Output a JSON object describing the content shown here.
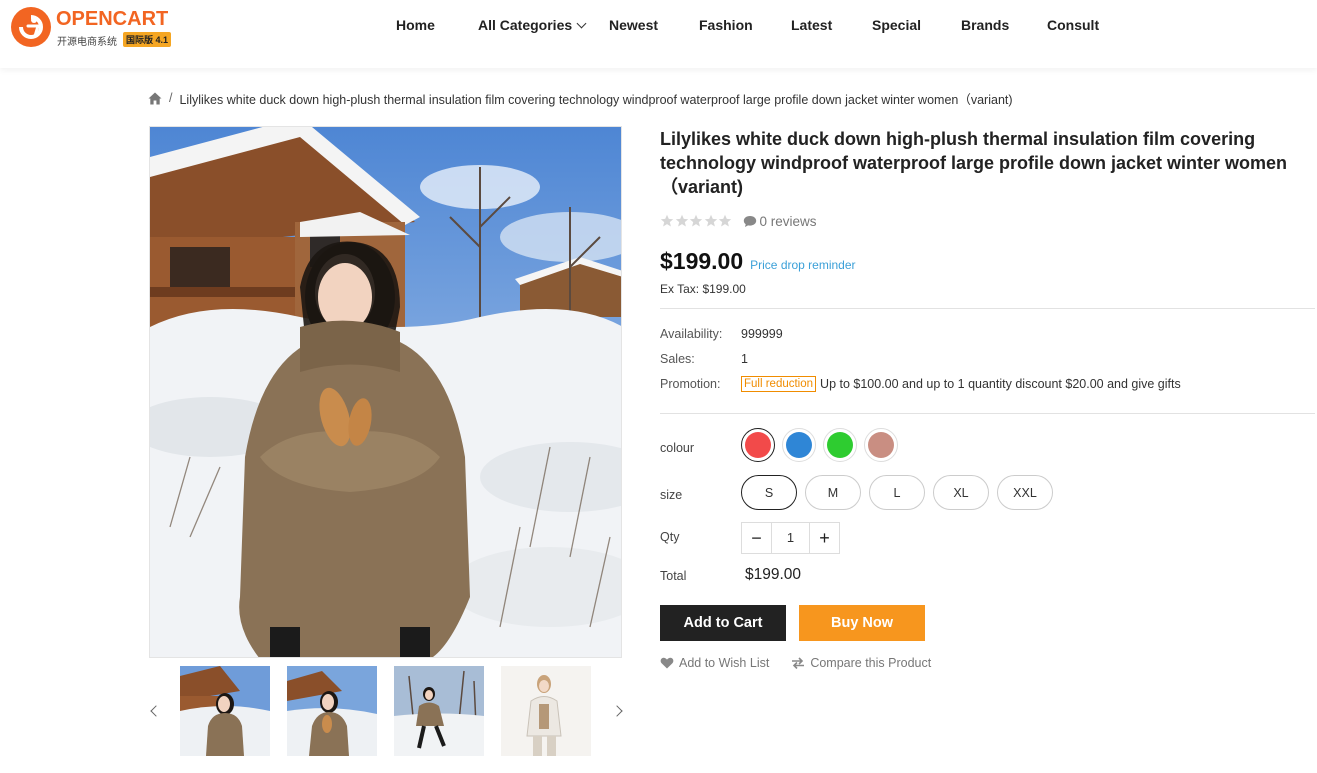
{
  "brand": {
    "name": "OPENCART",
    "subtitle": "开源电商系统",
    "badge": "国际版 4.1",
    "color": "#f26522"
  },
  "nav": {
    "items": [
      {
        "label": "Home"
      },
      {
        "label": "All Categories",
        "has_dropdown": true
      },
      {
        "label": "Newest"
      },
      {
        "label": "Fashion"
      },
      {
        "label": "Latest"
      },
      {
        "label": "Special"
      },
      {
        "label": "Brands"
      },
      {
        "label": "Consult"
      }
    ]
  },
  "breadcrumb": {
    "separator": "/",
    "current": "Lilylikes white duck down high-plush thermal insulation film covering technology windproof waterproof large profile down jacket winter women（variant)"
  },
  "product": {
    "title": "Lilylikes white duck down high-plush thermal insulation film covering technology windproof waterproof large profile down jacket winter women （variant)",
    "rating": 0,
    "reviews_text": "0 reviews",
    "price": "$199.00",
    "price_reminder": "Price drop reminder",
    "ex_tax": "Ex Tax: $199.00",
    "availability_label": "Availability:",
    "availability_value": "999999",
    "sales_label": "Sales:",
    "sales_value": "1",
    "promotion_label": "Promotion:",
    "promotion_tag": "Full reduction",
    "promotion_text": "Up to $100.00 and up to 1 quantity discount $20.00 and give gifts",
    "colour_label": "colour",
    "colours": [
      "#f24a4a",
      "#2f86d6",
      "#2ecc30",
      "#c98e82"
    ],
    "selected_colour": 0,
    "size_label": "size",
    "sizes": [
      "S",
      "M",
      "L",
      "XL",
      "XXL"
    ],
    "selected_size": "S",
    "qty_label": "Qty",
    "qty_value": "1",
    "qty_minus": "−",
    "qty_plus": "+",
    "total_label": "Total",
    "total_value": "$199.00",
    "add_to_cart": "Add to Cart",
    "buy_now": "Buy Now",
    "wishlist": "Add to Wish List",
    "compare": "Compare this Product"
  },
  "colors": {
    "accent_orange": "#f7961e",
    "link_blue": "#3ba0d8",
    "dark_button": "#222222"
  }
}
